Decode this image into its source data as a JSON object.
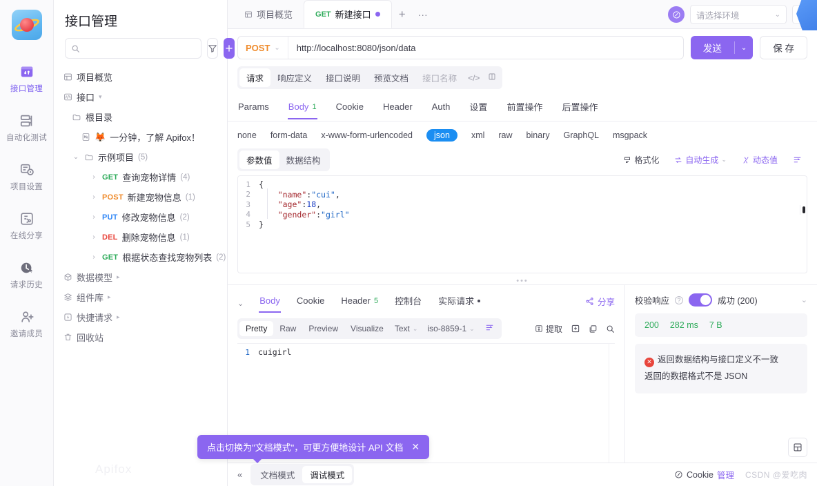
{
  "rail": {
    "logo_name": "apifox-logo",
    "items": [
      {
        "label": "接口管理",
        "icon": "api-manage-icon",
        "active": true
      },
      {
        "label": "自动化测试",
        "icon": "automation-test-icon",
        "active": false
      },
      {
        "label": "项目设置",
        "icon": "project-settings-icon",
        "active": false
      },
      {
        "label": "在线分享",
        "icon": "online-share-icon",
        "active": false
      },
      {
        "label": "请求历史",
        "icon": "request-history-icon",
        "active": false
      },
      {
        "label": "邀请成员",
        "icon": "invite-member-icon",
        "active": false
      }
    ]
  },
  "sidebar": {
    "title": "接口管理",
    "search_placeholder": "",
    "filter_icon": "filter-icon",
    "add_icon": "plus-icon",
    "watermark": "Apifox",
    "tree": [
      {
        "label": "项目概览",
        "icon": "overview-icon",
        "level": 0
      },
      {
        "label": "接口",
        "icon": "api-icon",
        "level": 0,
        "caret": "▾"
      },
      {
        "label": "根目录",
        "icon": "folder-icon",
        "level": 1
      },
      {
        "label": "一分钟，了解 Apifox！",
        "icon": "markdown-doc-icon",
        "emoji": "🦊",
        "level": 2
      },
      {
        "label": "示例项目",
        "icon": "folder-icon",
        "count": "(5)",
        "level": 1,
        "caret": "⌄"
      },
      {
        "method": "GET",
        "label": "查询宠物详情",
        "count": "(4)",
        "level": 2
      },
      {
        "method": "POST",
        "label": "新建宠物信息",
        "count": "(1)",
        "level": 2
      },
      {
        "method": "PUT",
        "label": "修改宠物信息",
        "count": "(2)",
        "level": 2
      },
      {
        "method": "DEL",
        "label": "删除宠物信息",
        "count": "(1)",
        "level": 2
      },
      {
        "method": "GET",
        "label": "根据状态查找宠物列表",
        "count": "(2)",
        "level": 2
      },
      {
        "label": "数据模型",
        "icon": "data-model-icon",
        "level": 0,
        "caret": "▸"
      },
      {
        "label": "组件库",
        "icon": "component-lib-icon",
        "level": 0,
        "caret": "▸"
      },
      {
        "label": "快捷请求",
        "icon": "quick-request-icon",
        "level": 0,
        "caret": "▸"
      },
      {
        "label": "回收站",
        "icon": "trash-icon",
        "level": 0
      }
    ]
  },
  "tabbar": {
    "tabs": [
      {
        "label": "项目概览",
        "icon": "overview-icon",
        "active": false
      },
      {
        "label": "新建接口",
        "method": "GET",
        "active": true,
        "modified": true
      }
    ],
    "add_label": "+",
    "more_label": "···",
    "env_placeholder": "请选择环境",
    "env_icon": "environment-icon",
    "menu_icon": "hamburger-icon"
  },
  "request": {
    "method": "POST",
    "url": "http://localhost:8080/json/data",
    "send_label": "发送",
    "save_label": "保 存",
    "doc_tabs": [
      {
        "label": "请求",
        "active": true
      },
      {
        "label": "响应定义",
        "active": false
      },
      {
        "label": "接口说明",
        "active": false
      },
      {
        "label": "预览文档",
        "active": false
      },
      {
        "label": "接口名称",
        "active": false,
        "dim": true
      }
    ],
    "doc_tab_icons": [
      "code-icon",
      "copy-icon"
    ],
    "tabs": [
      {
        "label": "Params",
        "active": false
      },
      {
        "label": "Body",
        "active": true,
        "badge": "1"
      },
      {
        "label": "Cookie",
        "active": false
      },
      {
        "label": "Header",
        "active": false
      },
      {
        "label": "Auth",
        "active": false
      },
      {
        "label": "设置",
        "active": false
      },
      {
        "label": "前置操作",
        "active": false
      },
      {
        "label": "后置操作",
        "active": false
      }
    ],
    "body_types": [
      {
        "label": "none",
        "active": false
      },
      {
        "label": "form-data",
        "active": false
      },
      {
        "label": "x-www-form-urlencoded",
        "active": false
      },
      {
        "label": "json",
        "active": true
      },
      {
        "label": "xml",
        "active": false
      },
      {
        "label": "raw",
        "active": false
      },
      {
        "label": "binary",
        "active": false
      },
      {
        "label": "GraphQL",
        "active": false
      },
      {
        "label": "msgpack",
        "active": false
      }
    ],
    "editor_seg": [
      {
        "label": "参数值",
        "active": true
      },
      {
        "label": "数据结构",
        "active": false
      }
    ],
    "editor_actions": [
      {
        "label": "格式化",
        "icon": "format-icon",
        "purple": false
      },
      {
        "label": "自动生成",
        "icon": "auto-generate-icon",
        "purple": true,
        "chev": true
      },
      {
        "label": "动态值",
        "icon": "dynamic-value-icon",
        "purple": true
      },
      {
        "label": "",
        "icon": "wrap-lines-icon",
        "purple": true
      }
    ],
    "code_lines": [
      {
        "n": "1",
        "tokens": [
          {
            "t": "{",
            "c": "brace"
          }
        ]
      },
      {
        "n": "2",
        "tokens": [
          {
            "t": "    ",
            "c": "punc"
          },
          {
            "t": "\"name\"",
            "c": "key"
          },
          {
            "t": ":",
            "c": "colon"
          },
          {
            "t": "\"cui\"",
            "c": "str"
          },
          {
            "t": ",",
            "c": "punc"
          }
        ]
      },
      {
        "n": "3",
        "tokens": [
          {
            "t": "    ",
            "c": "punc"
          },
          {
            "t": "\"age\"",
            "c": "key"
          },
          {
            "t": ":",
            "c": "colon"
          },
          {
            "t": "18",
            "c": "num"
          },
          {
            "t": ",",
            "c": "punc"
          }
        ]
      },
      {
        "n": "4",
        "tokens": [
          {
            "t": "    ",
            "c": "punc"
          },
          {
            "t": "\"gender\"",
            "c": "key"
          },
          {
            "t": ":",
            "c": "colon"
          },
          {
            "t": "\"girl\"",
            "c": "str"
          }
        ]
      },
      {
        "n": "5",
        "tokens": [
          {
            "t": "}",
            "c": "brace"
          }
        ]
      }
    ]
  },
  "response": {
    "collapse_caret": "⌄",
    "tabs": [
      {
        "label": "Body",
        "active": true
      },
      {
        "label": "Cookie",
        "active": false
      },
      {
        "label": "Header",
        "active": false,
        "badge": "5"
      },
      {
        "label": "控制台",
        "active": false
      },
      {
        "label": "实际请求",
        "active": false,
        "dot": true
      }
    ],
    "share_label": "分享",
    "share_icon": "share-icon",
    "view_modes": [
      {
        "label": "Pretty",
        "active": true
      },
      {
        "label": "Raw",
        "active": false
      },
      {
        "label": "Preview",
        "active": false
      },
      {
        "label": "Visualize",
        "active": false
      }
    ],
    "format_select": "Text",
    "charset_select": "iso-8859-1",
    "wrap_icon": "wrap-lines-icon",
    "actions": [
      {
        "label": "提取",
        "icon": "extract-icon"
      },
      {
        "label": "",
        "icon": "download-icon"
      },
      {
        "label": "",
        "icon": "copy-icon"
      },
      {
        "label": "",
        "icon": "search-icon"
      }
    ],
    "body_lines": [
      {
        "n": "1",
        "text": "cuigirl"
      }
    ],
    "verify": {
      "label": "校验响应",
      "help_icon": "help-icon",
      "toggle_on": true,
      "status_label": "成功 (200)",
      "chev": "⌄"
    },
    "stats": {
      "status": "200",
      "time": "282 ms",
      "size": "7 B"
    },
    "errors": [
      "返回数据结构与接口定义不一致",
      "返回的数据格式不是 JSON"
    ],
    "layout_icon": "layout-toggle-icon"
  },
  "toast": {
    "message": "点击切换为\"文档模式\"，可更方便地设计 API 文档",
    "close_icon": "close-icon"
  },
  "bottombar": {
    "collapse_icon": "collapse-left-icon",
    "modes": [
      {
        "label": "文档模式",
        "active": false
      },
      {
        "label": "调试模式",
        "active": true
      }
    ],
    "cookie_icon": "cookie-icon",
    "cookie_label": "Cookie ",
    "cookie_link": "管理",
    "watermark": "CSDN @爱吃肉"
  },
  "colors": {
    "accent": "#8b66f0",
    "method_get": "#2eab5a",
    "method_post": "#ef8b2c",
    "method_put": "#2f86f6",
    "method_del": "#e8453c",
    "json_active": "#1b8ef2",
    "success": "#2eab5a",
    "error": "#e8453c"
  }
}
